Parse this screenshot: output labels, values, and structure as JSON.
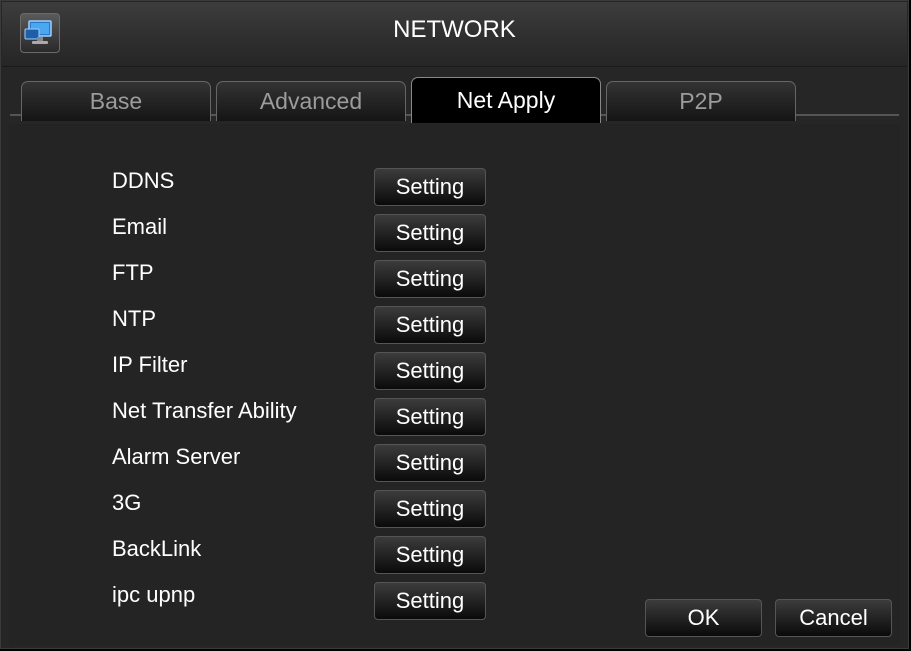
{
  "window": {
    "title": "NETWORK",
    "icon": "network-settings-icon"
  },
  "tabs": [
    {
      "label": "Base",
      "active": false
    },
    {
      "label": "Advanced",
      "active": false
    },
    {
      "label": "Net Apply",
      "active": true
    },
    {
      "label": "P2P",
      "active": false
    }
  ],
  "services": [
    {
      "label": "DDNS",
      "button": "Setting"
    },
    {
      "label": "Email",
      "button": "Setting"
    },
    {
      "label": "FTP",
      "button": "Setting"
    },
    {
      "label": "NTP",
      "button": "Setting"
    },
    {
      "label": "IP Filter",
      "button": "Setting"
    },
    {
      "label": "Net Transfer Ability",
      "button": "Setting"
    },
    {
      "label": "Alarm Server",
      "button": "Setting"
    },
    {
      "label": "3G",
      "button": "Setting"
    },
    {
      "label": "BackLink",
      "button": "Setting"
    },
    {
      "label": "ipc upnp",
      "button": "Setting"
    }
  ],
  "footer": {
    "ok_label": "OK",
    "cancel_label": "Cancel"
  },
  "colors": {
    "background": "#262626",
    "text": "#ffffff",
    "inactive_tab_text": "#9c9c9c"
  }
}
